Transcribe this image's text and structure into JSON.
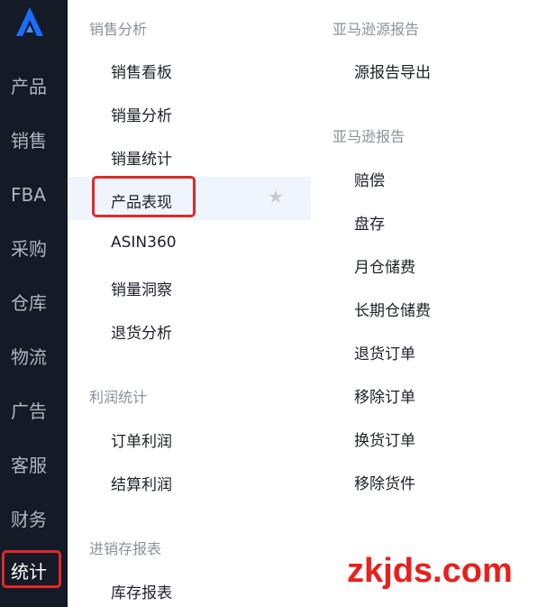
{
  "sidebar": {
    "logo_icon": "app-logo-icon",
    "brand_color": "#1a6dff",
    "items": [
      {
        "label": "产品"
      },
      {
        "label": "销售"
      },
      {
        "label": "FBA"
      },
      {
        "label": "采购"
      },
      {
        "label": "仓库"
      },
      {
        "label": "物流"
      },
      {
        "label": "广告"
      },
      {
        "label": "客服"
      },
      {
        "label": "财务"
      },
      {
        "label": "统计"
      }
    ],
    "active_index": 9
  },
  "menu": {
    "sales_analysis": {
      "title": "销售分析",
      "items": [
        "销售看板",
        "销量分析",
        "销量统计",
        "产品表现",
        "ASIN360",
        "销量洞察",
        "退货分析"
      ]
    },
    "profit_stats": {
      "title": "利润统计",
      "items": [
        "订单利润",
        "结算利润"
      ]
    },
    "inventory_report": {
      "title": "进销存报表",
      "items": [
        "库存报表"
      ]
    },
    "amazon_source_report": {
      "title": "亚马逊源报告",
      "items": [
        "源报告导出"
      ]
    },
    "amazon_report": {
      "title": "亚马逊报告",
      "items": [
        "赔偿",
        "盘存",
        "月仓储费",
        "长期仓储费",
        "退货订单",
        "移除订单",
        "换货订单",
        "移除货件"
      ]
    },
    "hovered_item_icon": "star-icon"
  },
  "colors": {
    "sidebar_bg": "#151a27",
    "highlight_red": "#e0282a",
    "hover_bg": "#f0f4fd"
  },
  "watermark": "zkjds.com"
}
